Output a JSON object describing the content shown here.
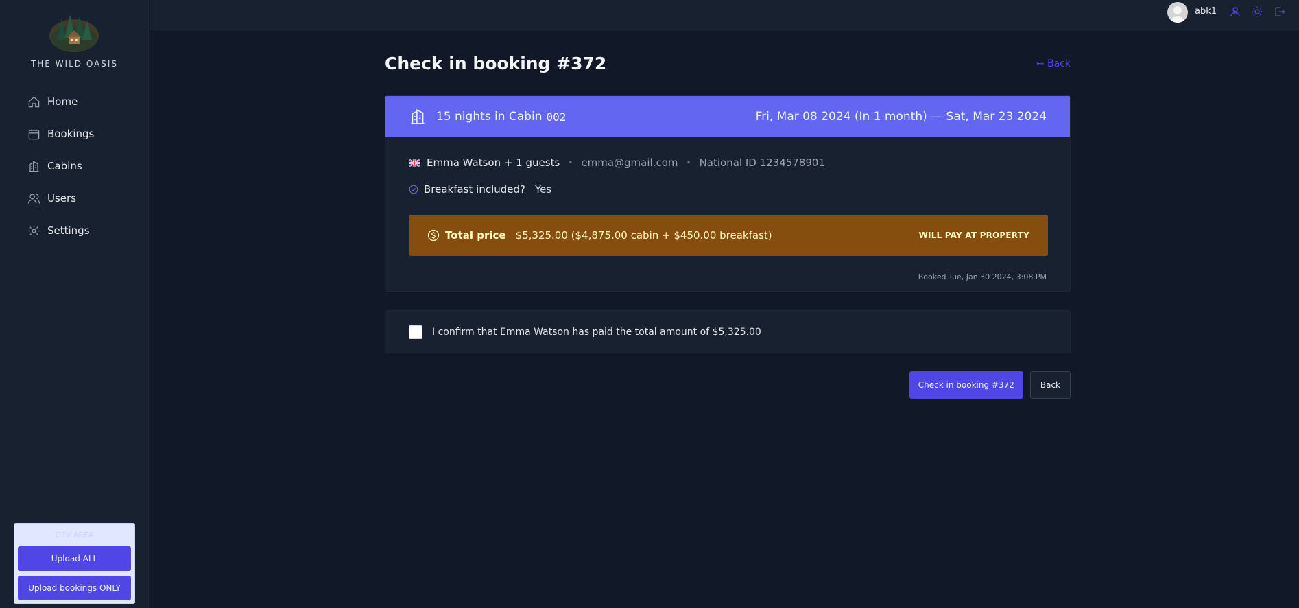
{
  "sidebar": {
    "logo_text": "THE WILD OASIS",
    "items": [
      {
        "label": "Home",
        "icon": "home-icon"
      },
      {
        "label": "Bookings",
        "icon": "calendar-icon"
      },
      {
        "label": "Cabins",
        "icon": "building-icon"
      },
      {
        "label": "Users",
        "icon": "users-icon"
      },
      {
        "label": "Settings",
        "icon": "gear-icon"
      }
    ],
    "upload": {
      "title": "DEV AREA",
      "upload_all_label": "Upload ALL",
      "upload_bookings_label": "Upload bookings ONLY"
    }
  },
  "header": {
    "username": "abk1",
    "icons": [
      "user-icon",
      "sun-icon",
      "logout-icon"
    ]
  },
  "page": {
    "title": "Check in booking #372",
    "back_link": "← Back"
  },
  "booking": {
    "nights_text": "15 nights in Cabin",
    "cabin_code": "002",
    "dates": "Fri, Mar 08 2024 (In 1 month) — Sat, Mar 23 2024",
    "guest": "Emma Watson + 1 guests",
    "separator": "•",
    "email": "emma@gmail.com",
    "national_id": "National ID 1234578901",
    "breakfast_label": "Breakfast included?",
    "breakfast_value": "Yes",
    "price_label": "Total price",
    "price_value": "$5,325.00 ($4,875.00 cabin + $450.00 breakfast)",
    "payment_status": "WILL PAY AT PROPERTY",
    "booked_at": "Booked Tue, Jan 30 2024, 3:08 PM",
    "colors": {
      "header": "#6366f1",
      "price_box": "#854d0e",
      "accent": "#4f46e5"
    }
  },
  "confirm": {
    "text": "I confirm that Emma Watson has paid the total amount of $5,325.00",
    "checked": false
  },
  "actions": {
    "checkin_label": "Check in booking #372",
    "back_label": "Back"
  }
}
